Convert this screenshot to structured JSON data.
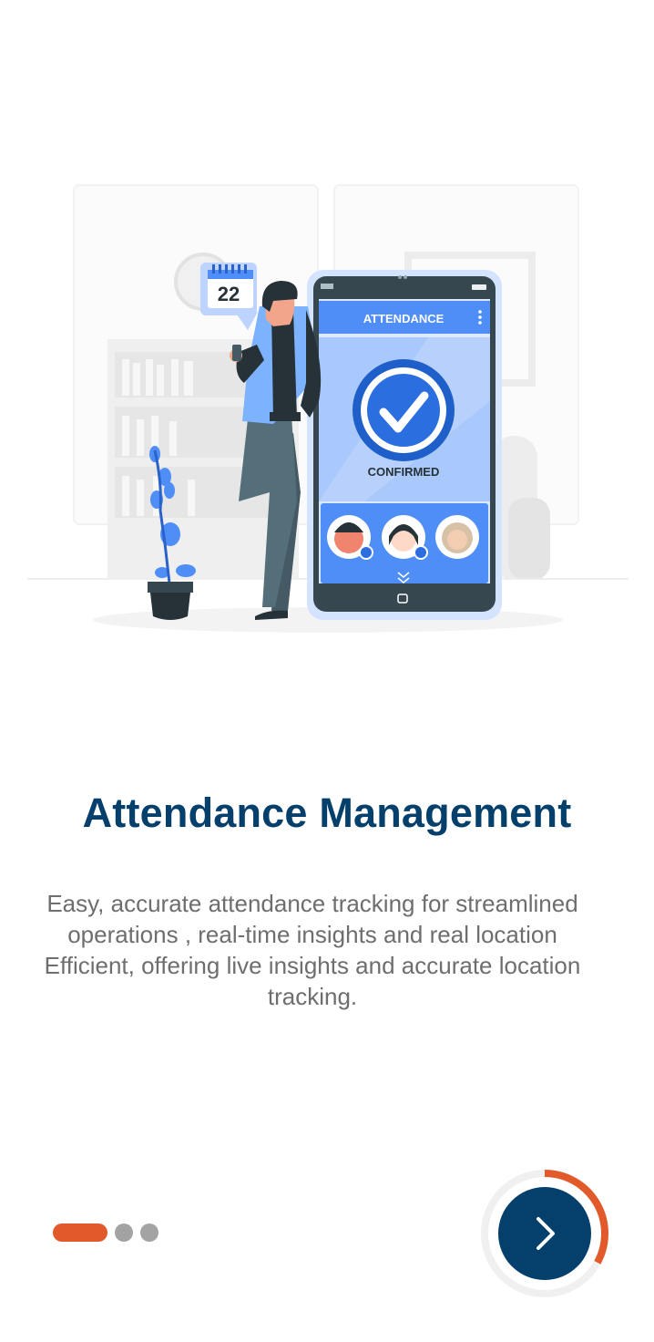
{
  "illustration": {
    "calendar_day": "22",
    "phone_header": "ATTENDANCE",
    "phone_status": "CONFIRMED",
    "icon": "attendance-illustration"
  },
  "onboarding": {
    "title": "Attendance Management",
    "description": "Easy, accurate attendance tracking for streamlined operations , real-time insights and real location Efficient, offering live insights  and accurate location tracking."
  },
  "pager": {
    "total_pages": 3,
    "current_page": 1,
    "progress_fraction": 0.33
  },
  "next_button": {
    "icon": "chevron-right-icon"
  },
  "colors": {
    "primary": "#053f6b",
    "accent": "#e25a2b",
    "illustration_blue": "#4f8ef7",
    "text_secondary": "#6e6e6e",
    "dot_inactive": "#a3a3a3"
  }
}
